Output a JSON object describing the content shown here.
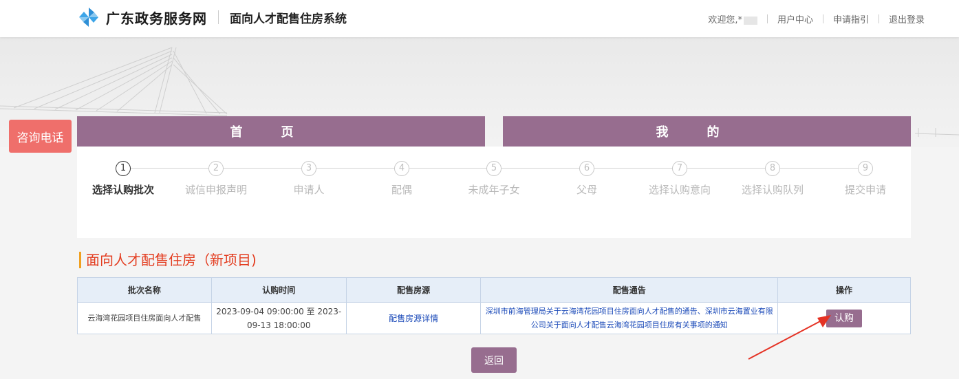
{
  "header": {
    "brand": "广东政务服务网",
    "system_name": "面向人才配售住房系统",
    "welcome": "欢迎您,*",
    "links": [
      "用户中心",
      "申请指引",
      "退出登录"
    ]
  },
  "consult": "咨询电话",
  "nav": {
    "home": "首页",
    "mine": "我的"
  },
  "steps": [
    {
      "num": "1",
      "label": "选择认购批次"
    },
    {
      "num": "2",
      "label": "诚信申报声明"
    },
    {
      "num": "3",
      "label": "申请人"
    },
    {
      "num": "4",
      "label": "配偶"
    },
    {
      "num": "5",
      "label": "未成年子女"
    },
    {
      "num": "6",
      "label": "父母"
    },
    {
      "num": "7",
      "label": "选择认购意向"
    },
    {
      "num": "8",
      "label": "选择认购队列"
    },
    {
      "num": "9",
      "label": "提交申请"
    }
  ],
  "section_title": "面向人才配售住房（新项目)",
  "table": {
    "headers": [
      "批次名称",
      "认购时间",
      "配售房源",
      "配售通告",
      "操作"
    ],
    "row": {
      "batch": "云海湾花园项目住房面向人才配售",
      "time": "2023-09-04 09:00:00 至 2023-09-13 18:00:00",
      "source": "配售房源详情",
      "notice": "深圳市前海管理局关于云海湾花园项目住房面向人才配售的通告、深圳市云海置业有限公司关于面向人才配售云海湾花园项目住房有关事项的通知",
      "action": "认购"
    }
  },
  "back": "返回",
  "colors": {
    "theme": "#976d8f",
    "consult": "#ef6f6b",
    "title": "#e33c1f",
    "link": "#1a49b8",
    "arrow": "#e53224"
  }
}
